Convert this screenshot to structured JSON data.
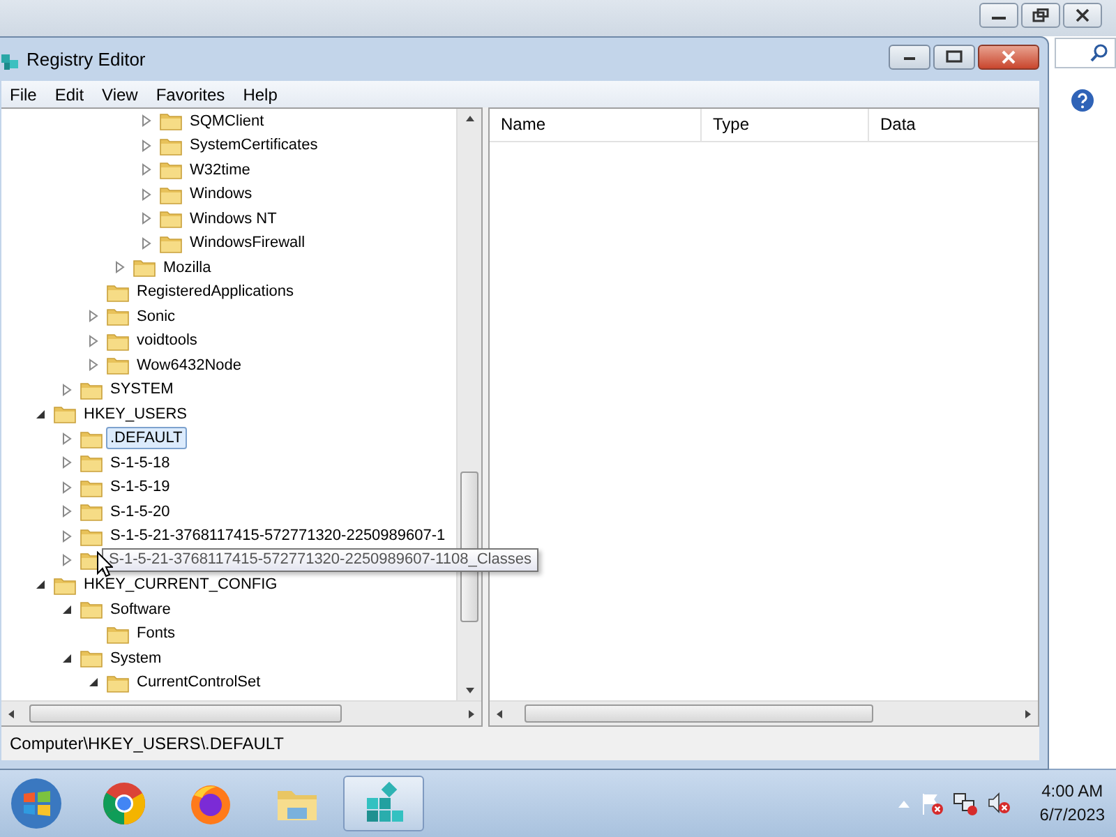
{
  "window": {
    "title": "Registry Editor"
  },
  "menu": [
    {
      "label": "File"
    },
    {
      "label": "Edit"
    },
    {
      "label": "View"
    },
    {
      "label": "Favorites"
    },
    {
      "label": "Help"
    }
  ],
  "tree": [
    {
      "children": [
        {
          "children": [
            {
              "children": [
                {
                  "children": [
                    {
                      "label": "SQMClient",
                      "expanded": false,
                      "selected": false
                    },
                    {
                      "label": "SystemCertificates",
                      "expanded": false,
                      "selected": false
                    },
                    {
                      "label": "W32time",
                      "expanded": false,
                      "selected": false
                    },
                    {
                      "label": "Windows",
                      "expanded": false,
                      "selected": false
                    },
                    {
                      "label": "Windows NT",
                      "expanded": false,
                      "selected": false
                    },
                    {
                      "label": "WindowsFirewall",
                      "expanded": false,
                      "selected": false
                    }
                  ]
                },
                {
                  "label": "Mozilla",
                  "expanded": false,
                  "selected": false
                }
              ]
            },
            {
              "label": "RegisteredApplications",
              "selected": false
            },
            {
              "label": "Sonic",
              "expanded": false,
              "selected": false
            },
            {
              "label": "voidtools",
              "expanded": false,
              "selected": false
            },
            {
              "label": "Wow6432Node",
              "expanded": false,
              "selected": false
            }
          ]
        },
        {
          "label": "SYSTEM",
          "expanded": false,
          "selected": false
        }
      ]
    },
    {
      "label": "HKEY_USERS",
      "expanded": true,
      "selected": false,
      "children": [
        {
          "label": ".DEFAULT",
          "expanded": false,
          "selected": true
        },
        {
          "label": "S-1-5-18",
          "expanded": false,
          "selected": false
        },
        {
          "label": "S-1-5-19",
          "expanded": false,
          "selected": false
        },
        {
          "label": "S-1-5-20",
          "expanded": false,
          "selected": false
        },
        {
          "label": "S-1-5-21-3768117415-572771320-2250989607-1",
          "expanded": false,
          "selected": false
        },
        {
          "tooltip": "S-1-5-21-3768117415-572771320-2250989607-1108_Classes",
          "expanded": false,
          "selected": false
        }
      ]
    },
    {
      "label": "HKEY_CURRENT_CONFIG",
      "expanded": true,
      "selected": false,
      "children": [
        {
          "label": "Software",
          "expanded": true,
          "selected": false,
          "children": [
            {
              "label": "Fonts",
              "selected": false
            }
          ]
        },
        {
          "label": "System",
          "expanded": true,
          "selected": false,
          "children": [
            {
              "label": "CurrentControlSet",
              "expanded": true,
              "selected": false
            }
          ]
        }
      ]
    }
  ],
  "values": {
    "columns": [
      "Name",
      "Type",
      "Data"
    ]
  },
  "status_bar": "Computer\\HKEY_USERS\\.DEFAULT",
  "taskbar": {
    "apps": [
      {
        "kind": "chrome",
        "active": false
      },
      {
        "kind": "firefox",
        "active": false
      },
      {
        "kind": "explorer",
        "active": false
      },
      {
        "kind": "regedit",
        "active": true
      }
    ],
    "time": "4:00 AM",
    "date": "6/7/2023"
  }
}
